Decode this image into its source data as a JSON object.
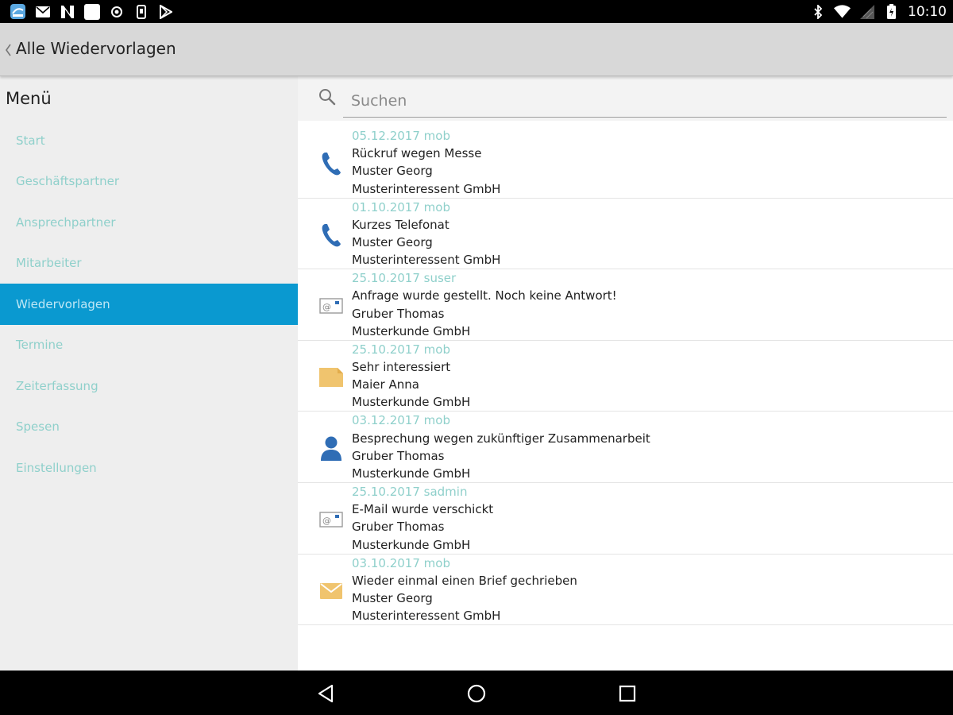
{
  "status_bar": {
    "time": "10:10",
    "left_icons": [
      "app-icon",
      "mail-icon",
      "n-icon",
      "square-icon",
      "target-icon",
      "sim-icon",
      "play-store-icon"
    ],
    "right_icons": [
      "bluetooth-icon",
      "wifi-icon",
      "signal-icon",
      "battery-icon"
    ]
  },
  "action_bar": {
    "title": "Alle Wiedervorlagen"
  },
  "sidebar": {
    "title": "Menü",
    "items": [
      {
        "label": "Start"
      },
      {
        "label": "Geschäftspartner"
      },
      {
        "label": "Ansprechpartner"
      },
      {
        "label": "Mitarbeiter"
      },
      {
        "label": "Wiedervorlagen",
        "active": true
      },
      {
        "label": "Termine"
      },
      {
        "label": "Zeiterfassung"
      },
      {
        "label": "Spesen"
      },
      {
        "label": "Einstellungen"
      }
    ]
  },
  "search": {
    "placeholder": "Suchen"
  },
  "entries": [
    {
      "icon": "phone-icon",
      "meta": "05.12.2017 mob",
      "subject": "Rückruf wegen Messe",
      "person": "Muster Georg",
      "company": "Musterinteressent GmbH"
    },
    {
      "icon": "phone-icon",
      "meta": "01.10.2017 mob",
      "subject": "Kurzes Telefonat",
      "person": "Muster Georg",
      "company": "Musterinteressent GmbH"
    },
    {
      "icon": "email-icon",
      "meta": "25.10.2017 suser",
      "subject": "Anfrage wurde gestellt. Noch keine Antwort!",
      "person": "Gruber Thomas",
      "company": "Musterkunde GmbH"
    },
    {
      "icon": "note-icon",
      "meta": "25.10.2017 mob",
      "subject": "Sehr interessiert",
      "person": "Maier Anna",
      "company": "Musterkunde GmbH"
    },
    {
      "icon": "person-icon",
      "meta": "03.12.2017 mob",
      "subject": "Besprechung wegen zukünftiger Zusammenarbeit",
      "person": "Gruber Thomas",
      "company": "Musterkunde GmbH"
    },
    {
      "icon": "email-icon",
      "meta": "25.10.2017 sadmin",
      "subject": "E-Mail wurde verschickt",
      "person": "Gruber Thomas",
      "company": "Musterkunde GmbH"
    },
    {
      "icon": "letter-icon",
      "meta": "03.10.2017 mob",
      "subject": "Wieder einmal einen Brief gechrieben",
      "person": "Muster Georg",
      "company": "Musterinteressent GmbH"
    }
  ],
  "colors": {
    "accent": "#0a99d0",
    "meta_text": "#8fd0cb",
    "phone_icon": "#2f6db5",
    "note_icon": "#f0c46e"
  },
  "nav_bar": {
    "buttons": [
      "back-icon",
      "home-icon",
      "recents-icon"
    ]
  }
}
